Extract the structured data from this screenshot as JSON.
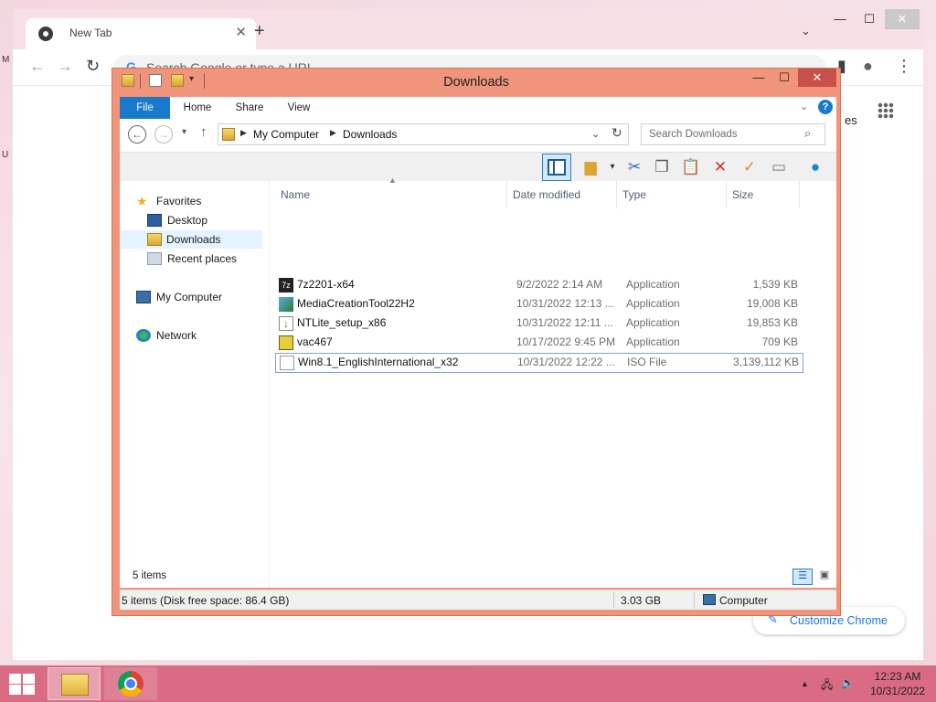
{
  "chrome": {
    "tab_title": "New Tab",
    "omnibox_placeholder": "Search Google or type a URL",
    "apps_partial_label": "es",
    "customize_label": "Customize Chrome"
  },
  "explorer": {
    "window_title": "Downloads",
    "ribbon_tabs": [
      "File",
      "Home",
      "Share",
      "View"
    ],
    "breadcrumb": [
      "My Computer",
      "Downloads"
    ],
    "search_placeholder": "Search Downloads",
    "nav_pane": {
      "favorites": "Favorites",
      "desktop": "Desktop",
      "downloads": "Downloads",
      "recent": "Recent places",
      "my_computer": "My Computer",
      "network": "Network"
    },
    "columns": [
      "Name",
      "Date modified",
      "Type",
      "Size"
    ],
    "files": [
      {
        "name": "7z2201-x64",
        "date": "9/2/2022 2:14 AM",
        "type": "Application",
        "size": "1,539 KB",
        "icon": "7zip-icon"
      },
      {
        "name": "MediaCreationTool22H2",
        "date": "10/31/2022 12:13 ...",
        "type": "Application",
        "size": "19,008 KB",
        "icon": "media-creation-icon"
      },
      {
        "name": "NTLite_setup_x86",
        "date": "10/31/2022 12:11 ...",
        "type": "Application",
        "size": "19,853 KB",
        "icon": "ntlite-icon"
      },
      {
        "name": "vac467",
        "date": "10/17/2022 9:45 PM",
        "type": "Application",
        "size": "709 KB",
        "icon": "vac-icon"
      },
      {
        "name": "Win8.1_EnglishInternational_x32",
        "date": "10/31/2022 12:22 ...",
        "type": "ISO File",
        "size": "3,139,112 KB",
        "icon": "iso-file-icon"
      }
    ],
    "item_count": "5 items",
    "status": {
      "left": "5 items (Disk free space: 86.4 GB)",
      "size": "3.03 GB",
      "location": "Computer"
    }
  },
  "taskbar": {
    "time": "12:23 AM",
    "date": "10/31/2022"
  },
  "colors": {
    "explorer_frame": "#f0957b",
    "ribbon_file": "#1979ca",
    "taskbar": "#d96b82"
  }
}
